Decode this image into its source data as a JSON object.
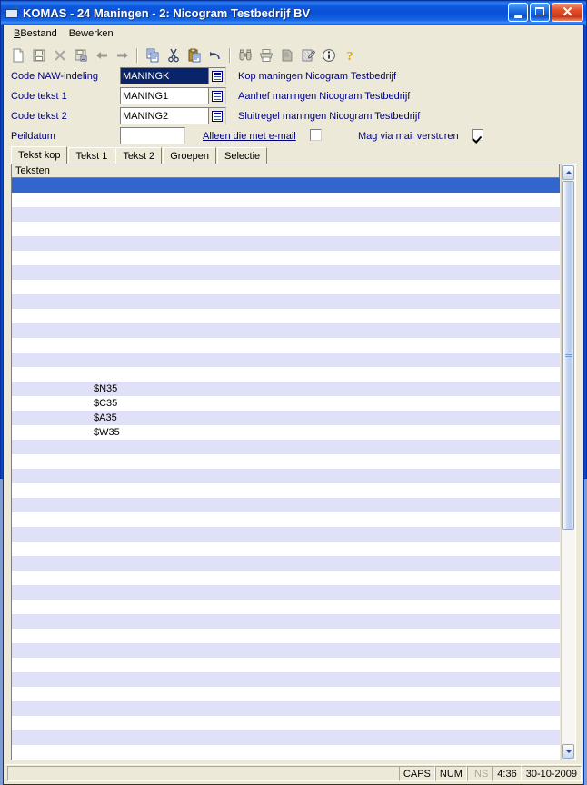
{
  "window": {
    "title": "KOMAS - 24 Maningen - 2: Nicogram Testbedrijf BV",
    "icon": "app-window-icon",
    "minimize_label": "",
    "maximize_label": "",
    "close_label": "✕"
  },
  "menu": {
    "items": [
      {
        "label": "Bestand",
        "accel": "B"
      },
      {
        "label": "Bewerken",
        "accel": "w"
      }
    ]
  },
  "toolbar": {
    "buttons": [
      {
        "name": "new-icon",
        "title": "Nieuw"
      },
      {
        "name": "save-icon",
        "title": "Opslaan"
      },
      {
        "name": "delete-icon",
        "title": "Verwijderen"
      },
      {
        "name": "save-as-icon",
        "title": "Opslaan als"
      },
      {
        "name": "back-arrow-icon",
        "title": "Vorige"
      },
      {
        "name": "forward-arrow-icon",
        "title": "Volgende"
      },
      {
        "name": "copy-icon",
        "title": "Kopieren"
      },
      {
        "name": "cut-icon",
        "title": "Knippen"
      },
      {
        "name": "paste-icon",
        "title": "Plakken"
      },
      {
        "name": "undo-icon",
        "title": "Ongedaan maken"
      },
      {
        "name": "find-binoculars-icon",
        "title": "Zoeken"
      },
      {
        "name": "print-icon",
        "title": "Afdrukken"
      },
      {
        "name": "preview-icon",
        "title": "Afdrukvoorbeeld"
      },
      {
        "name": "edit-list-icon",
        "title": "Bewerken"
      },
      {
        "name": "info-icon",
        "title": "Info"
      },
      {
        "name": "help-icon",
        "title": "Help"
      }
    ]
  },
  "form": {
    "rows": [
      {
        "label": "Code NAW-indeling",
        "value": "MANINGK",
        "selected": true,
        "description": "Kop maningen Nicogram Testbedrijf",
        "lookup": "lookup-icon"
      },
      {
        "label": "Code tekst 1",
        "value": "MANING1",
        "selected": false,
        "description": "Aanhef maningen Nicogram Testbedrijf",
        "lookup": "lookup-icon"
      },
      {
        "label": "Code tekst 2",
        "value": "MANING2",
        "selected": false,
        "description": "Sluitregel maningen Nicogram Testbedrijf",
        "lookup": "lookup-icon"
      }
    ],
    "peildatum": {
      "label": "Peildatum",
      "value": "",
      "placeholder": ""
    },
    "checkboxes": [
      {
        "label": "Alleen die met e-mail",
        "accel": "A",
        "checked": false
      },
      {
        "label": "Mag via mail versturen",
        "accel": "m",
        "checked": true
      }
    ]
  },
  "tabs": {
    "items": [
      {
        "label": "Tekst kop",
        "accel": "k",
        "active": true
      },
      {
        "label": "Tekst 1",
        "accel": "1",
        "active": false
      },
      {
        "label": "Tekst 2",
        "accel": "2",
        "active": false
      },
      {
        "label": "Groepen",
        "accel": "G",
        "active": false
      },
      {
        "label": "Selectie",
        "accel": "e",
        "active": false
      }
    ]
  },
  "grid": {
    "column_header": "Teksten",
    "rows": [
      {
        "text": "",
        "selected": true
      },
      {
        "text": "",
        "selected": false
      },
      {
        "text": "",
        "selected": false
      },
      {
        "text": "",
        "selected": false
      },
      {
        "text": "",
        "selected": false
      },
      {
        "text": "",
        "selected": false
      },
      {
        "text": "",
        "selected": false
      },
      {
        "text": "",
        "selected": false
      },
      {
        "text": "",
        "selected": false
      },
      {
        "text": "",
        "selected": false
      },
      {
        "text": "",
        "selected": false
      },
      {
        "text": "",
        "selected": false
      },
      {
        "text": "",
        "selected": false
      },
      {
        "text": "",
        "selected": false
      },
      {
        "text": "$N35",
        "selected": false
      },
      {
        "text": "$C35",
        "selected": false
      },
      {
        "text": "$A35",
        "selected": false
      },
      {
        "text": "$W35",
        "selected": false
      }
    ],
    "scrollbar": {
      "up_arrow": "scroll-up-icon",
      "down_arrow": "scroll-down-icon",
      "thumb_fraction": 0.62
    }
  },
  "statusbar": {
    "message": "",
    "panes": [
      {
        "label": "CAPS",
        "dim": false
      },
      {
        "label": "NUM",
        "dim": false
      },
      {
        "label": "INS",
        "dim": true
      },
      {
        "label": "4:36",
        "dim": false
      },
      {
        "label": "30-10-2009",
        "dim": false
      }
    ]
  },
  "colors": {
    "titlebar_blue": "#0a4fd8",
    "face": "#ece9d8",
    "label_navy": "#000080",
    "selection_blue": "#3366cc",
    "row_alt": "#e0e0f8",
    "text_selection": "#0a246a"
  }
}
